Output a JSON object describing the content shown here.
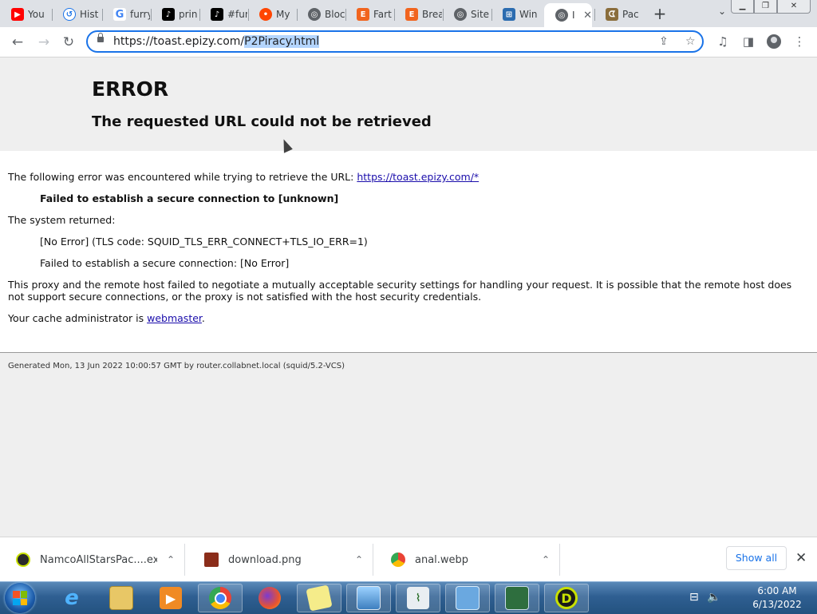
{
  "tabs": [
    {
      "title": "You",
      "icon": "youtube-icon",
      "color": "#ff0000"
    },
    {
      "title": "Hist",
      "icon": "history-icon",
      "color": "#1a73e8"
    },
    {
      "title": "furry",
      "icon": "google-icon",
      "color": "#4285f4"
    },
    {
      "title": "prin",
      "icon": "tiktok-icon",
      "color": "#000000"
    },
    {
      "title": "#fur",
      "icon": "tiktok-icon",
      "color": "#000000"
    },
    {
      "title": "My",
      "icon": "reddit-icon",
      "color": "#ff4500"
    },
    {
      "title": "Bloc",
      "icon": "globe-icon",
      "color": "#5f6368"
    },
    {
      "title": "Fart",
      "icon": "etsy-icon",
      "color": "#f1641e"
    },
    {
      "title": "Brea",
      "icon": "etsy-icon",
      "color": "#f1641e"
    },
    {
      "title": "Site",
      "icon": "globe-icon",
      "color": "#5f6368"
    },
    {
      "title": "Win",
      "icon": "windows-icon",
      "color": "#2b6cb0"
    },
    {
      "title": "I",
      "icon": "globe-icon",
      "color": "#5f6368",
      "active": true
    },
    {
      "title": "Pac",
      "icon": "pacman-icon",
      "color": "#8a6d3b"
    }
  ],
  "toolbar": {
    "url_prefix": "https://toast.epizy.com/",
    "url_selected": "P2Piracy.html"
  },
  "page": {
    "title": "ERROR",
    "subtitle": "The requested URL could not be retrieved",
    "line1_text": "The following error was encountered while trying to retrieve the URL: ",
    "line1_link": "https://toast.epizy.com/*",
    "line2": "Failed to establish a secure connection to [unknown]",
    "line3": "The system returned:",
    "line4": "[No Error] (TLS code: SQUID_TLS_ERR_CONNECT+TLS_IO_ERR=1)",
    "line5": "Failed to establish a secure connection: [No Error]",
    "line6": "This proxy and the remote host failed to negotiate a mutually acceptable security settings for handling your request. It is possible that the remote host does not support secure connections, or the proxy is not satisfied with the host security credentials.",
    "line7_text": "Your cache administrator is ",
    "line7_link": "webmaster",
    "line7_end": ".",
    "footer": "Generated Mon, 13 Jun 2022 10:00:57 GMT by router.collabnet.local (squid/5.2-VCS)"
  },
  "downloads": [
    {
      "name": "NamcoAllStarsPac....exe",
      "icon": "exe-icon",
      "color": "#2a2a2a"
    },
    {
      "name": "download.png",
      "icon": "image-file-icon",
      "color": "#8b2d1a"
    },
    {
      "name": "anal.webp",
      "icon": "chrome-icon",
      "color": "#4285f4"
    }
  ],
  "shelf": {
    "show_all": "Show all"
  },
  "clock": {
    "time": "6:00 AM",
    "date": "6/13/2022"
  }
}
